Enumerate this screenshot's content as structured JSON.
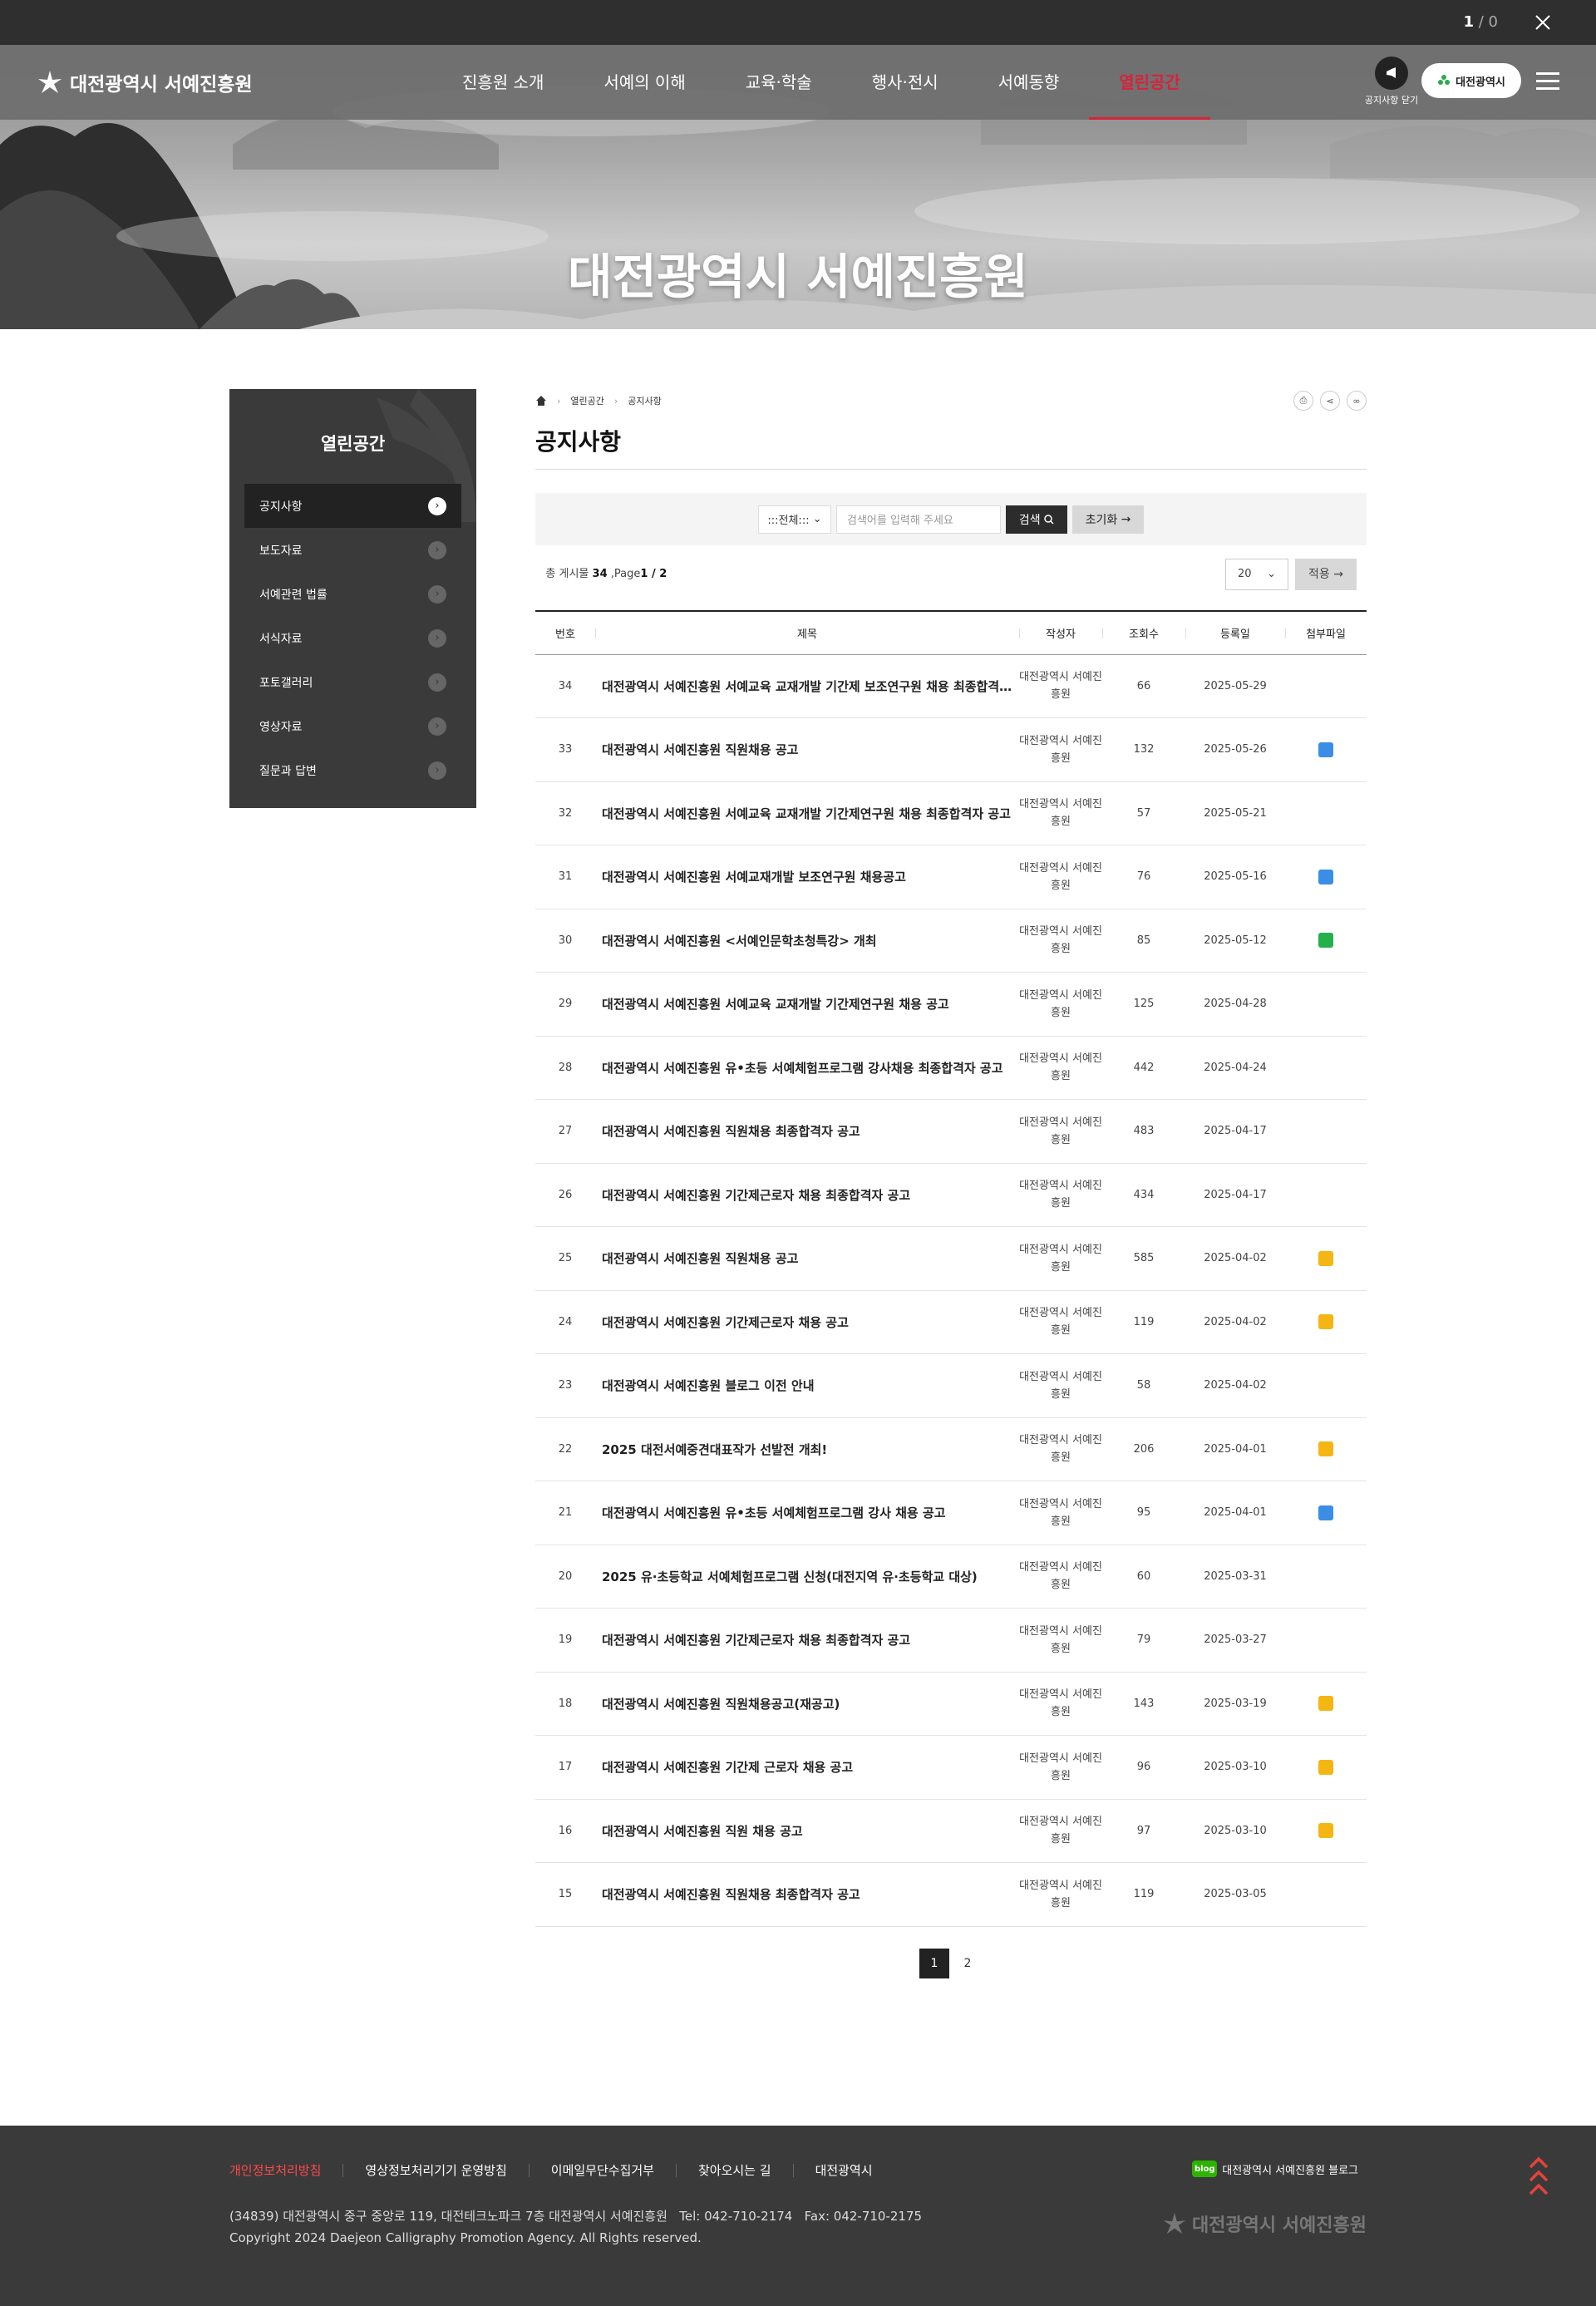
{
  "topbar": {
    "current": "1",
    "separator": "/",
    "total": "0"
  },
  "logo": {
    "text": "대전광역시 서예진흥원"
  },
  "gnb": [
    "진흥원 소개",
    "서예의 이해",
    "교육·학술",
    "행사·전시",
    "서예동향",
    "열린공간"
  ],
  "header": {
    "notice_close": "공지사항 닫기",
    "city_button": "대전광역시"
  },
  "hero": {
    "title": "대전광역시 서예진흥원"
  },
  "lnb": {
    "title": "열린공간",
    "items": [
      "공지사항",
      "보도자료",
      "서예관련 법률",
      "서식자료",
      "포토갤러리",
      "영상자료",
      "질문과 답변"
    ]
  },
  "breadcrumb": [
    "열린공간",
    "공지사항"
  ],
  "page_title": "공지사항",
  "search": {
    "select": ":::전체:::",
    "placeholder": "검색어를 입력해 주세요",
    "search_button": "검색",
    "reset_button": "초기화"
  },
  "list_info": {
    "label": "총 게시물",
    "total": "34",
    "page_label": ",Page",
    "page": "1 / 2",
    "rows": "20",
    "apply_button": "적용"
  },
  "table": {
    "headers": [
      "번호",
      "제목",
      "작성자",
      "조회수",
      "등록일",
      "첨부파일"
    ],
    "rows": [
      {
        "no": "34",
        "title": "대전광역시 서예진흥원 서예교육 교재개발 기간제 보조연구원 채용 최종합격자 공고",
        "writer": "대전광역시 서예진흥원",
        "views": "66",
        "date": "2025-05-29",
        "file": ""
      },
      {
        "no": "33",
        "title": "대전광역시 서예진흥원 직원채용 공고",
        "writer": "대전광역시 서예진흥원",
        "views": "132",
        "date": "2025-05-26",
        "file": "hwp"
      },
      {
        "no": "32",
        "title": "대전광역시 서예진흥원 서예교육 교재개발 기간제연구원 채용 최종합격자 공고",
        "writer": "대전광역시 서예진흥원",
        "views": "57",
        "date": "2025-05-21",
        "file": ""
      },
      {
        "no": "31",
        "title": "대전광역시 서예진흥원 서예교재개발 보조연구원 채용공고",
        "writer": "대전광역시 서예진흥원",
        "views": "76",
        "date": "2025-05-16",
        "file": "hwp"
      },
      {
        "no": "30",
        "title": "대전광역시 서예진흥원 <서예인문학초청특강> 개최",
        "writer": "대전광역시 서예진흥원",
        "views": "85",
        "date": "2025-05-12",
        "file": "xls"
      },
      {
        "no": "29",
        "title": "대전광역시 서예진흥원 서예교육 교재개발 기간제연구원 채용 공고",
        "writer": "대전광역시 서예진흥원",
        "views": "125",
        "date": "2025-04-28",
        "file": ""
      },
      {
        "no": "28",
        "title": "대전광역시 서예진흥원 유•초등 서예체험프로그램 강사채용 최종합격자 공고",
        "writer": "대전광역시 서예진흥원",
        "views": "442",
        "date": "2025-04-24",
        "file": ""
      },
      {
        "no": "27",
        "title": "대전광역시 서예진흥원 직원채용 최종합격자 공고",
        "writer": "대전광역시 서예진흥원",
        "views": "483",
        "date": "2025-04-17",
        "file": ""
      },
      {
        "no": "26",
        "title": "대전광역시 서예진흥원 기간제근로자 채용 최종합격자 공고",
        "writer": "대전광역시 서예진흥원",
        "views": "434",
        "date": "2025-04-17",
        "file": ""
      },
      {
        "no": "25",
        "title": "대전광역시 서예진흥원 직원채용 공고",
        "writer": "대전광역시 서예진흥원",
        "views": "585",
        "date": "2025-04-02",
        "file": "doc"
      },
      {
        "no": "24",
        "title": "대전광역시 서예진흥원 기간제근로자 채용 공고",
        "writer": "대전광역시 서예진흥원",
        "views": "119",
        "date": "2025-04-02",
        "file": "doc"
      },
      {
        "no": "23",
        "title": "대전광역시 서예진흥원 블로그 이전 안내",
        "writer": "대전광역시 서예진흥원",
        "views": "58",
        "date": "2025-04-02",
        "file": ""
      },
      {
        "no": "22",
        "title": "2025 대전서예중견대표작가 선발전 개최!",
        "writer": "대전광역시 서예진흥원",
        "views": "206",
        "date": "2025-04-01",
        "file": "doc"
      },
      {
        "no": "21",
        "title": "대전광역시 서예진흥원 유•초등 서예체험프로그램 강사 채용 공고",
        "writer": "대전광역시 서예진흥원",
        "views": "95",
        "date": "2025-04-01",
        "file": "hwp"
      },
      {
        "no": "20",
        "title": "2025 유·초등학교 서예체험프로그램 신청(대전지역 유·초등학교 대상)",
        "writer": "대전광역시 서예진흥원",
        "views": "60",
        "date": "2025-03-31",
        "file": ""
      },
      {
        "no": "19",
        "title": "대전광역시 서예진흥원 기간제근로자 채용 최종합격자 공고",
        "writer": "대전광역시 서예진흥원",
        "views": "79",
        "date": "2025-03-27",
        "file": ""
      },
      {
        "no": "18",
        "title": "대전광역시 서예진흥원 직원채용공고(재공고)",
        "writer": "대전광역시 서예진흥원",
        "views": "143",
        "date": "2025-03-19",
        "file": "doc"
      },
      {
        "no": "17",
        "title": "대전광역시 서예진흥원 기간제 근로자 채용 공고",
        "writer": "대전광역시 서예진흥원",
        "views": "96",
        "date": "2025-03-10",
        "file": "doc"
      },
      {
        "no": "16",
        "title": "대전광역시 서예진흥원 직원 채용 공고",
        "writer": "대전광역시 서예진흥원",
        "views": "97",
        "date": "2025-03-10",
        "file": "doc"
      },
      {
        "no": "15",
        "title": "대전광역시 서예진흥원 직원채용 최종합격자 공고",
        "writer": "대전광역시 서예진흥원",
        "views": "119",
        "date": "2025-03-05",
        "file": ""
      }
    ]
  },
  "pagination": [
    "1",
    "2"
  ],
  "footer": {
    "links": [
      "개인정보처리방침",
      "영상정보처리기기 운영방침",
      "이메일무단수집거부",
      "찾아오시는 길",
      "대전광역시"
    ],
    "address": "(34839) 대전광역시 중구 중앙로 119, 대전테크노파크 7층 대전광역시 서예진흥원",
    "tel": "Tel: 042-710-2174",
    "fax": "Fax: 042-710-2175",
    "copyright": "Copyright 2024 Daejeon Calligraphy Promotion Agency. All Rights reserved.",
    "blog_badge": "blog",
    "blog_label": "대전광역시 서예진흥원 블로그",
    "logo_text": "대전광역시 서예진흥원"
  }
}
